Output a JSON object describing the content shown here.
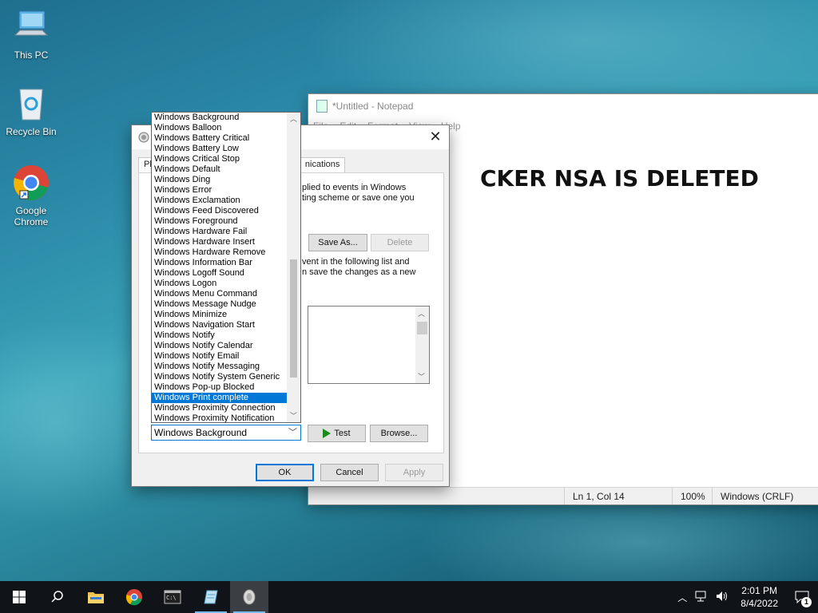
{
  "desktop": {
    "icons": [
      {
        "label": "This PC"
      },
      {
        "label": "Recycle Bin"
      },
      {
        "label": "Google Chrome"
      }
    ]
  },
  "notepad": {
    "title": "*Untitled - Notepad",
    "menu": [
      "File",
      "Edit",
      "Format",
      "View",
      "Help"
    ],
    "content": "CKER NSA IS DELETED",
    "status": {
      "position": "Ln 1, Col 14",
      "zoom": "100%",
      "line_ending": "Windows (CRLF)"
    }
  },
  "sound_dialog": {
    "close": "✕",
    "tabs": [
      "Pla",
      "nications"
    ],
    "desc_top": "plied to events in Windows\nting scheme or save one you",
    "desc_mid": "vent in the following list and\nn save the changes as a new",
    "save_as": "Save As...",
    "delete": "Delete",
    "test": "Test",
    "browse": "Browse...",
    "ok": "OK",
    "cancel": "Cancel",
    "apply": "Apply",
    "selected_sound": "Windows Background"
  },
  "dropdown": {
    "items": [
      "Windows Background",
      "Windows Balloon",
      "Windows Battery Critical",
      "Windows Battery Low",
      "Windows Critical Stop",
      "Windows Default",
      "Windows Ding",
      "Windows Error",
      "Windows Exclamation",
      "Windows Feed Discovered",
      "Windows Foreground",
      "Windows Hardware Fail",
      "Windows Hardware Insert",
      "Windows Hardware Remove",
      "Windows Information Bar",
      "Windows Logoff Sound",
      "Windows Logon",
      "Windows Menu Command",
      "Windows Message Nudge",
      "Windows Minimize",
      "Windows Navigation Start",
      "Windows Notify",
      "Windows Notify Calendar",
      "Windows Notify Email",
      "Windows Notify Messaging",
      "Windows Notify System Generic",
      "Windows Pop-up Blocked",
      "Windows Print complete",
      "Windows Proximity Connection",
      "Windows Proximity Notification"
    ],
    "highlighted": "Windows Print complete"
  },
  "taskbar": {
    "time": "2:01 PM",
    "date": "8/4/2022",
    "notification_count": "1",
    "apps": [
      "start",
      "search",
      "file-explorer",
      "chrome",
      "terminal",
      "notepad",
      "sound"
    ]
  },
  "colors": {
    "accent": "#0078d7",
    "taskbar": "#101418"
  }
}
